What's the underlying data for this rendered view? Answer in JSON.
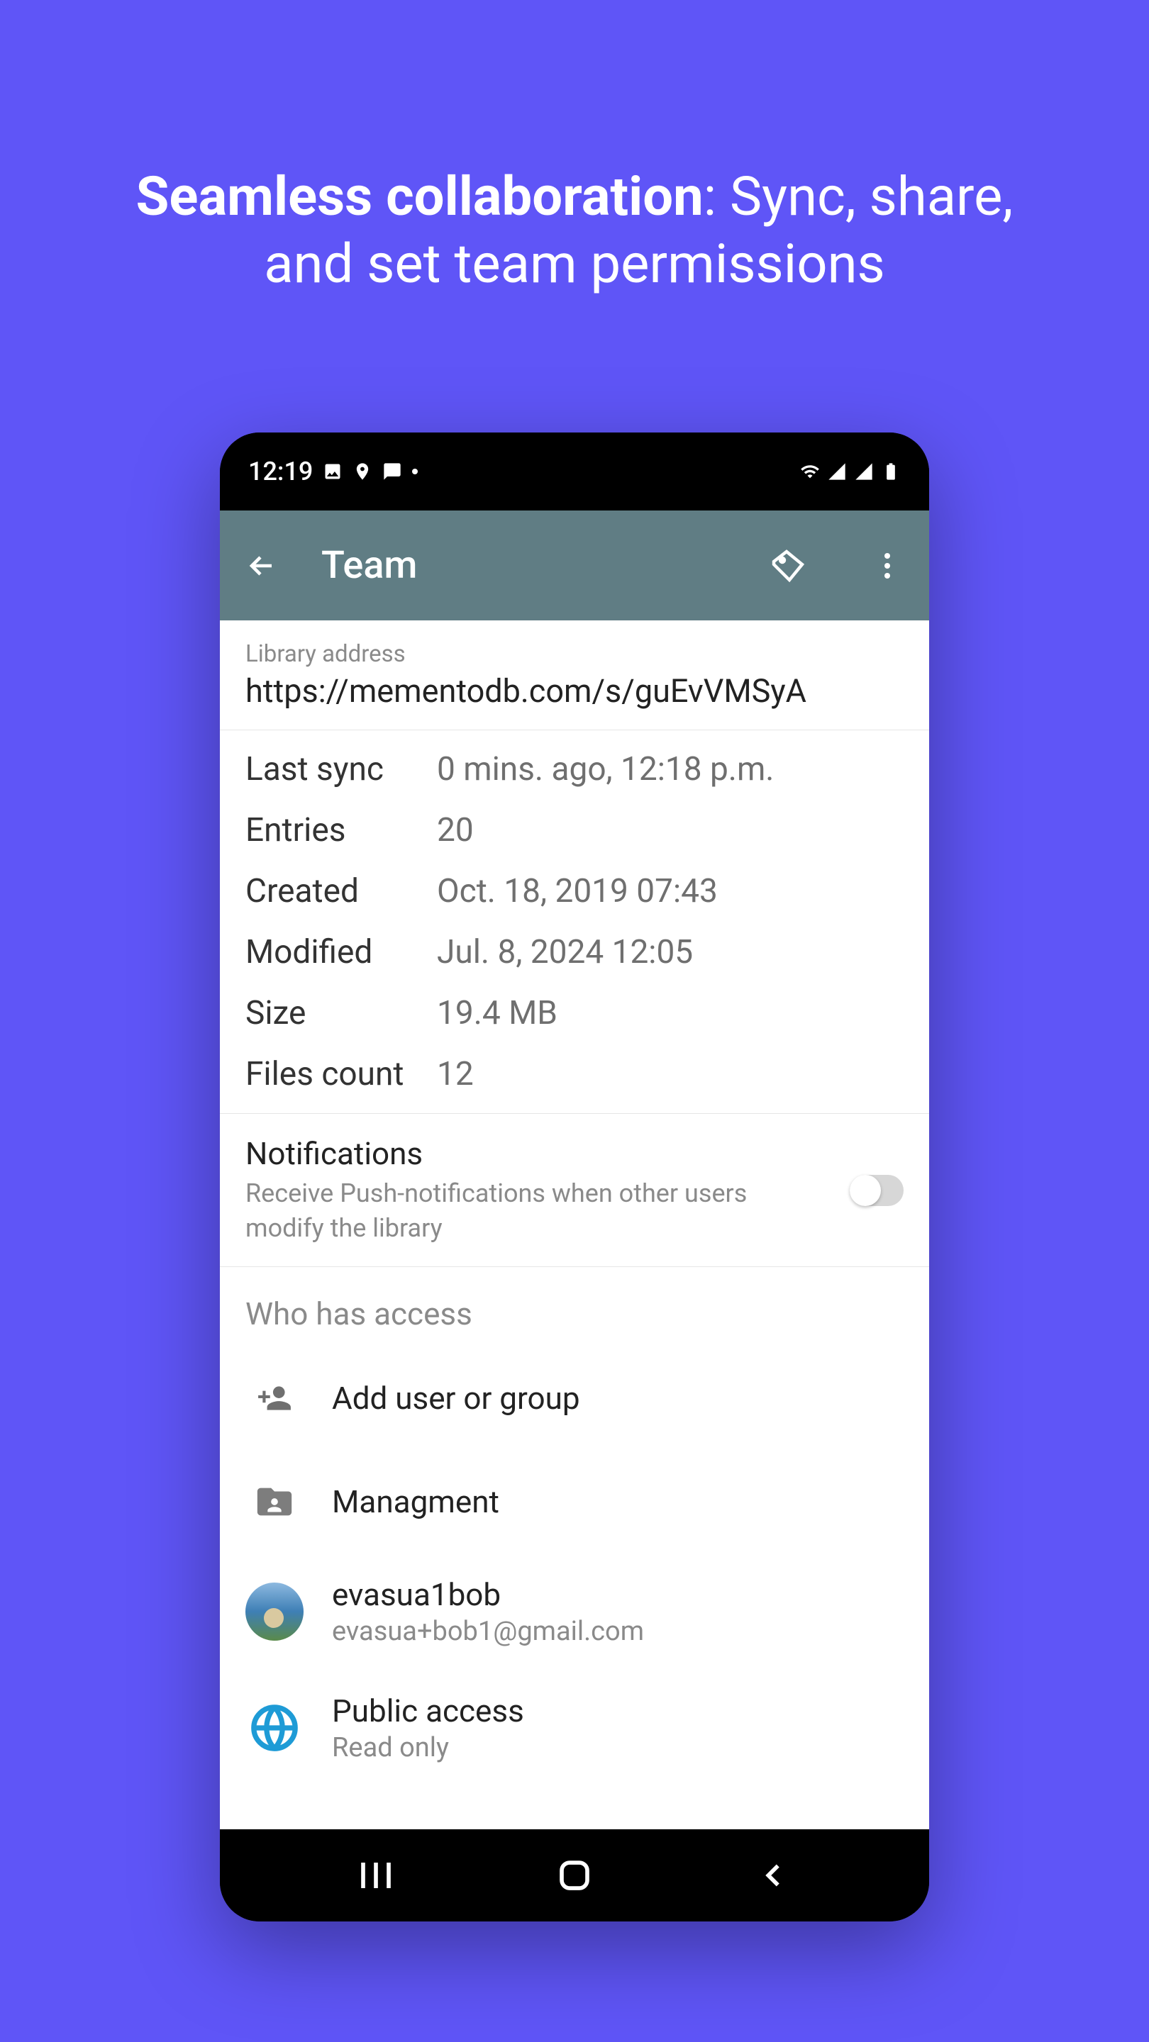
{
  "headline": {
    "bold": "Seamless collaboration",
    "rest": ": Sync, share, and set team permissions"
  },
  "statusbar": {
    "time": "12:19"
  },
  "appbar": {
    "title": "Team"
  },
  "library": {
    "label": "Library address",
    "url": "https://mementodb.com/s/guEvVMSyA"
  },
  "stats": [
    {
      "key": "Last sync",
      "val": "0 mins. ago, 12:18 p.m."
    },
    {
      "key": "Entries",
      "val": "20"
    },
    {
      "key": "Created",
      "val": "Oct. 18, 2019 07:43"
    },
    {
      "key": "Modified",
      "val": "Jul. 8, 2024 12:05"
    },
    {
      "key": "Size",
      "val": "19.4 MB"
    },
    {
      "key": "Files count",
      "val": "12"
    }
  ],
  "notifications": {
    "title": "Notifications",
    "sub": "Receive Push-notifications when other users modify the library"
  },
  "access": {
    "title": "Who has access",
    "add": "Add user or group",
    "group": "Managment",
    "user": {
      "name": "evasua1bob",
      "email": "evasua+bob1@gmail.com"
    },
    "public": {
      "title": "Public access",
      "sub": "Read only"
    }
  }
}
